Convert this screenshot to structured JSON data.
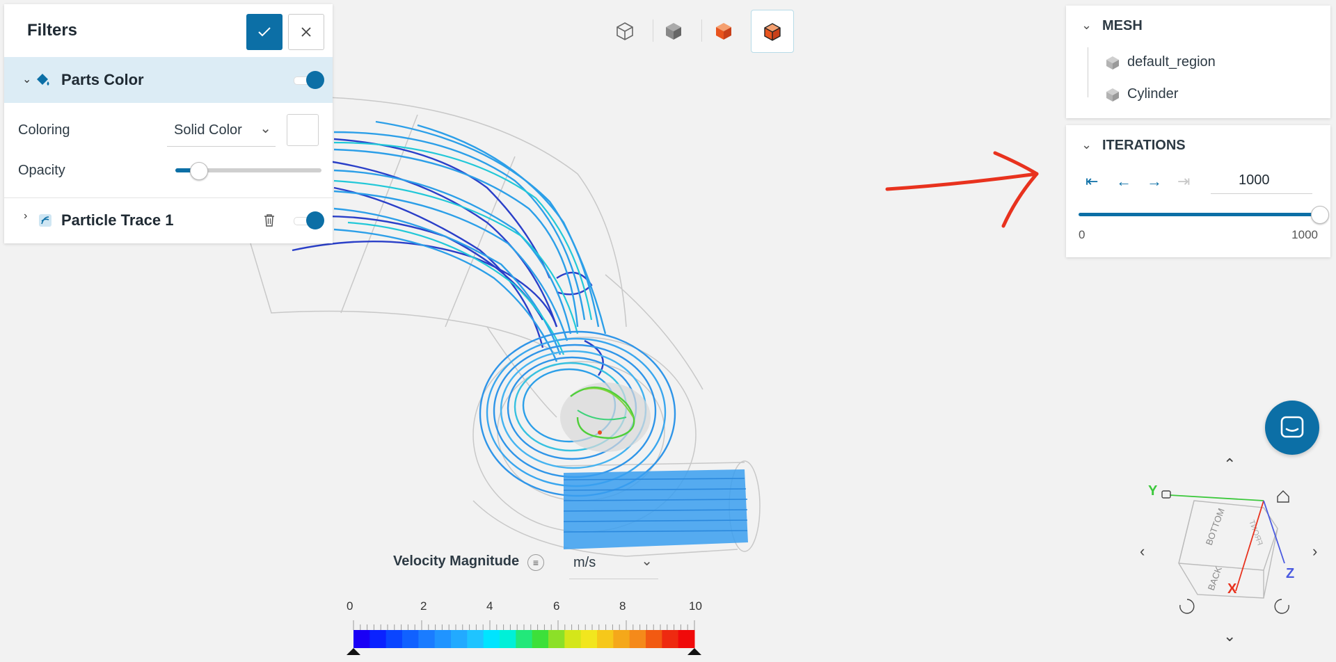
{
  "filters": {
    "title": "Filters",
    "items": [
      {
        "label": "Parts Color",
        "enabled": true,
        "expanded": true
      },
      {
        "label": "Particle Trace 1",
        "enabled": true,
        "expanded": false
      }
    ],
    "coloring_label": "Coloring",
    "coloring_value": "Solid Color",
    "opacity_label": "Opacity",
    "opacity_value": 0.1
  },
  "view_toolbar": [
    "wireframe-cube-icon",
    "solid-cube-icon",
    "surface-cube-icon",
    "surface-edges-cube-icon"
  ],
  "mesh": {
    "title": "MESH",
    "items": [
      "default_region",
      "Cylinder"
    ]
  },
  "iterations": {
    "title": "ITERATIONS",
    "value": "1000",
    "min_label": "0",
    "max_label": "1000",
    "slider_fraction": 1.0
  },
  "legend": {
    "title": "Velocity Magnitude",
    "unit": "m/s",
    "ticks": [
      "0",
      "2",
      "4",
      "6",
      "8",
      "10"
    ]
  },
  "nav_cube": {
    "faces": [
      "BOTTOM",
      "BACK",
      "FRONT"
    ],
    "axes": {
      "x": "X",
      "y": "Y",
      "z": "Z"
    }
  },
  "colors": {
    "accent": "#0c6fa6",
    "annotation": "#e8321e"
  }
}
